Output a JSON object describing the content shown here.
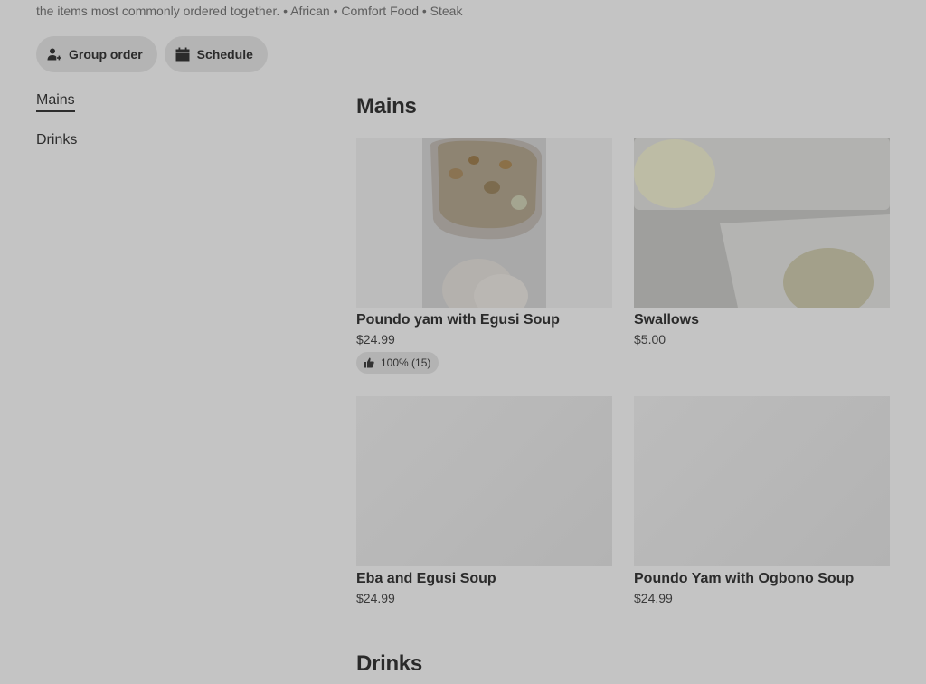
{
  "store": {
    "subtitle": "the items most commonly ordered together. • African • Comfort Food • Steak"
  },
  "actions": {
    "group_order": "Group order",
    "schedule": "Schedule"
  },
  "nav": {
    "items": [
      {
        "label": "Mains",
        "active": true
      },
      {
        "label": "Drinks",
        "active": false
      }
    ]
  },
  "sections": [
    {
      "title": "Mains",
      "items": [
        {
          "name": "Poundo yam with Egusi Soup",
          "price": "$24.99",
          "rating": "100% (15)"
        },
        {
          "name": "Swallows",
          "price": "$5.00"
        },
        {
          "name": "Eba and Egusi Soup",
          "price": "$24.99"
        },
        {
          "name": "Poundo Yam with Ogbono Soup",
          "price": "$24.99"
        }
      ]
    },
    {
      "title": "Drinks",
      "items": []
    }
  ],
  "icons": {
    "group_order": "person-plus-icon",
    "schedule": "calendar-icon",
    "rating": "thumbs-up-icon"
  }
}
